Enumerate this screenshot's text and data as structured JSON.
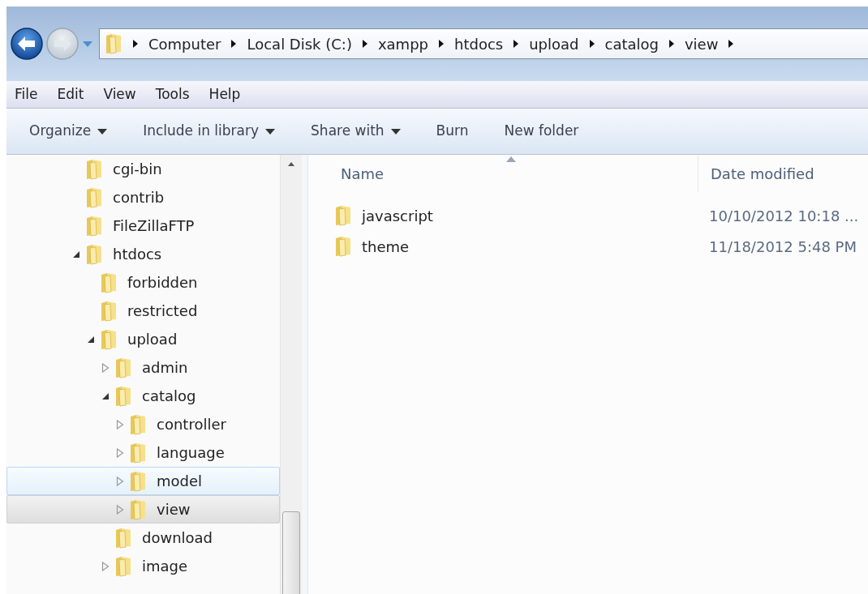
{
  "navigation": {
    "back": {
      "disabled": false
    },
    "forward": {
      "disabled": true
    }
  },
  "address_bar": {
    "crumbs": [
      "Computer",
      "Local Disk (C:)",
      "xampp",
      "htdocs",
      "upload",
      "catalog",
      "view"
    ]
  },
  "menu_bar": [
    "File",
    "Edit",
    "View",
    "Tools",
    "Help"
  ],
  "toolbar": [
    {
      "label": "Organize",
      "dropdown": true
    },
    {
      "label": "Include in library",
      "dropdown": true
    },
    {
      "label": "Share with",
      "dropdown": true
    },
    {
      "label": "Burn",
      "dropdown": false
    },
    {
      "label": "New folder",
      "dropdown": false
    }
  ],
  "tree": [
    {
      "label": "cgi-bin",
      "selected": false,
      "hovered": false
    },
    {
      "label": "contrib",
      "selected": false,
      "hovered": false
    },
    {
      "label": "FileZillaFTP",
      "selected": false,
      "hovered": false
    },
    {
      "label": "htdocs",
      "selected": false,
      "hovered": false,
      "expanded": true,
      "children": [
        {
          "label": "forbidden",
          "selected": false,
          "hovered": false
        },
        {
          "label": "restricted",
          "selected": false,
          "hovered": false
        },
        {
          "label": "upload",
          "selected": false,
          "hovered": false,
          "expanded": true,
          "children": [
            {
              "label": "admin",
              "selected": false,
              "hovered": false,
              "expanded": false
            },
            {
              "label": "catalog",
              "selected": false,
              "hovered": false,
              "expanded": true,
              "children": [
                {
                  "label": "controller",
                  "selected": false,
                  "hovered": false,
                  "expanded": false
                },
                {
                  "label": "language",
                  "selected": false,
                  "hovered": false,
                  "expanded": false
                },
                {
                  "label": "model",
                  "selected": false,
                  "hovered": true,
                  "expanded": false
                },
                {
                  "label": "view",
                  "selected": true,
                  "hovered": false,
                  "expanded": false
                }
              ]
            },
            {
              "label": "download",
              "selected": false,
              "hovered": false
            },
            {
              "label": "image",
              "selected": false,
              "hovered": false,
              "expanded": false
            }
          ]
        }
      ]
    }
  ],
  "file_list": {
    "columns": [
      "Name",
      "Date modified"
    ],
    "rows": [
      {
        "name": "javascript",
        "date_modified": "10/10/2012 10:18 ..."
      },
      {
        "name": "theme",
        "date_modified": "11/18/2012 5:48 PM"
      }
    ]
  }
}
